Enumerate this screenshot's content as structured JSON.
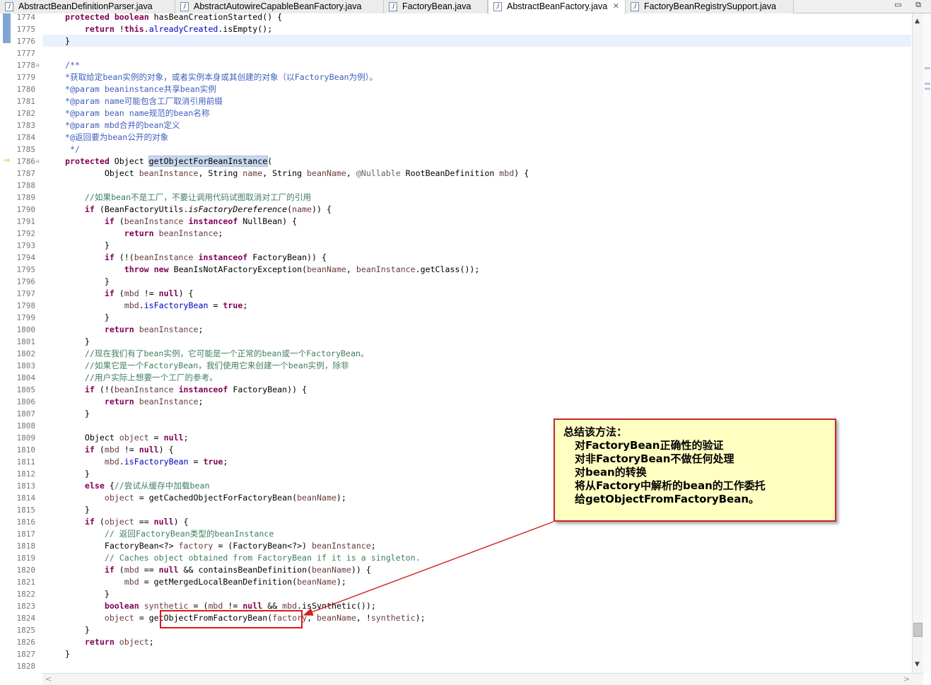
{
  "tabs": [
    {
      "label": "AbstractBeanDefinitionParser.java",
      "active": false
    },
    {
      "label": "AbstractAutowireCapableBeanFactory.java",
      "active": false
    },
    {
      "label": "FactoryBean.java",
      "active": false
    },
    {
      "label": "AbstractBeanFactory.java",
      "active": true,
      "close": "✕"
    },
    {
      "label": "FactoryBeanRegistrySupport.java",
      "active": false
    }
  ],
  "window_buttons": "▭ ⧉",
  "java_file_icon": "J",
  "editor": {
    "lines": [
      {
        "n": "1774",
        "segs": [
          [
            "kw",
            "protected"
          ],
          [
            "p",
            " "
          ],
          [
            "kw",
            "boolean"
          ],
          [
            "p",
            " hasBeanCreationStarted() {"
          ]
        ]
      },
      {
        "n": "1775",
        "segs": [
          [
            "p",
            "    "
          ],
          [
            "kw",
            "return"
          ],
          [
            "p",
            " !"
          ],
          [
            "kw",
            "this"
          ],
          [
            "p",
            "."
          ],
          [
            "fd",
            "alreadyCreated"
          ],
          [
            "p",
            ".isEmpty();"
          ]
        ]
      },
      {
        "n": "1776",
        "segs": [
          [
            "p",
            "}"
          ]
        ]
      },
      {
        "n": "1777",
        "segs": []
      },
      {
        "n": "1778",
        "segs": [
          [
            "jd",
            "/**"
          ]
        ]
      },
      {
        "n": "1779",
        "segs": [
          [
            "jd",
            "*获取给定bean实例的对象，或者实例本身或其创建的对象（以FactoryBean为例）。"
          ]
        ]
      },
      {
        "n": "1780",
        "segs": [
          [
            "jd",
            "*@param beaninstance共享bean实例"
          ]
        ]
      },
      {
        "n": "1781",
        "segs": [
          [
            "jd",
            "*@param name可能包含工厂取消引用前缀"
          ]
        ]
      },
      {
        "n": "1782",
        "segs": [
          [
            "jd",
            "*@param bean name规范的bean名称"
          ]
        ]
      },
      {
        "n": "1783",
        "segs": [
          [
            "jd",
            "*@param mbd合并的bean定义"
          ]
        ]
      },
      {
        "n": "1784",
        "segs": [
          [
            "jd",
            "*@返回要为bean公开的对象"
          ]
        ]
      },
      {
        "n": "1785",
        "segs": [
          [
            "jd",
            " */"
          ]
        ]
      },
      {
        "n": "1786",
        "segs": [
          [
            "kw",
            "protected"
          ],
          [
            "p",
            " Object "
          ],
          [
            "mh",
            "getObjectForBeanInstance"
          ],
          [
            "p",
            "("
          ]
        ]
      },
      {
        "n": "1787",
        "segs": [
          [
            "p",
            "        Object "
          ],
          [
            "lv",
            "beanInstance"
          ],
          [
            "p",
            ", String "
          ],
          [
            "lv",
            "name"
          ],
          [
            "p",
            ", String "
          ],
          [
            "lv",
            "beanName"
          ],
          [
            "p",
            ", "
          ],
          [
            "an",
            "@Nullable"
          ],
          [
            "p",
            " RootBeanDefinition "
          ],
          [
            "lv",
            "mbd"
          ],
          [
            "p",
            ") {"
          ]
        ]
      },
      {
        "n": "1788",
        "segs": []
      },
      {
        "n": "1789",
        "segs": [
          [
            "p",
            "    "
          ],
          [
            "cm",
            "//如果bean不是工厂，不要让调用代码试图取消对工厂的引用"
          ]
        ]
      },
      {
        "n": "1790",
        "segs": [
          [
            "p",
            "    "
          ],
          [
            "kw",
            "if"
          ],
          [
            "p",
            " (BeanFactoryUtils."
          ],
          [
            "it",
            "isFactoryDereference"
          ],
          [
            "p",
            "("
          ],
          [
            "lv",
            "name"
          ],
          [
            "p",
            ")) {"
          ]
        ]
      },
      {
        "n": "1791",
        "segs": [
          [
            "p",
            "        "
          ],
          [
            "kw",
            "if"
          ],
          [
            "p",
            " ("
          ],
          [
            "lv",
            "beanInstance"
          ],
          [
            "p",
            " "
          ],
          [
            "kw",
            "instanceof"
          ],
          [
            "p",
            " NullBean) {"
          ]
        ]
      },
      {
        "n": "1792",
        "segs": [
          [
            "p",
            "            "
          ],
          [
            "kw",
            "return"
          ],
          [
            "p",
            " "
          ],
          [
            "lv",
            "beanInstance"
          ],
          [
            "p",
            ";"
          ]
        ]
      },
      {
        "n": "1793",
        "segs": [
          [
            "p",
            "        }"
          ]
        ]
      },
      {
        "n": "1794",
        "segs": [
          [
            "p",
            "        "
          ],
          [
            "kw",
            "if"
          ],
          [
            "p",
            " (!("
          ],
          [
            "lv",
            "beanInstance"
          ],
          [
            "p",
            " "
          ],
          [
            "kw",
            "instanceof"
          ],
          [
            "p",
            " FactoryBean)) {"
          ]
        ]
      },
      {
        "n": "1795",
        "segs": [
          [
            "p",
            "            "
          ],
          [
            "kw",
            "throw"
          ],
          [
            "p",
            " "
          ],
          [
            "kw",
            "new"
          ],
          [
            "p",
            " BeanIsNotAFactoryException("
          ],
          [
            "lv",
            "beanName"
          ],
          [
            "p",
            ", "
          ],
          [
            "lv",
            "beanInstance"
          ],
          [
            "p",
            ".getClass());"
          ]
        ]
      },
      {
        "n": "1796",
        "segs": [
          [
            "p",
            "        }"
          ]
        ]
      },
      {
        "n": "1797",
        "segs": [
          [
            "p",
            "        "
          ],
          [
            "kw",
            "if"
          ],
          [
            "p",
            " ("
          ],
          [
            "lv",
            "mbd"
          ],
          [
            "p",
            " != "
          ],
          [
            "kw",
            "null"
          ],
          [
            "p",
            ") {"
          ]
        ]
      },
      {
        "n": "1798",
        "segs": [
          [
            "p",
            "            "
          ],
          [
            "lv",
            "mbd"
          ],
          [
            "p",
            "."
          ],
          [
            "fd",
            "isFactoryBean"
          ],
          [
            "p",
            " = "
          ],
          [
            "kw",
            "true"
          ],
          [
            "p",
            ";"
          ]
        ]
      },
      {
        "n": "1799",
        "segs": [
          [
            "p",
            "        }"
          ]
        ]
      },
      {
        "n": "1800",
        "segs": [
          [
            "p",
            "        "
          ],
          [
            "kw",
            "return"
          ],
          [
            "p",
            " "
          ],
          [
            "lv",
            "beanInstance"
          ],
          [
            "p",
            ";"
          ]
        ]
      },
      {
        "n": "1801",
        "segs": [
          [
            "p",
            "    }"
          ]
        ]
      },
      {
        "n": "1802",
        "segs": [
          [
            "p",
            "    "
          ],
          [
            "cm",
            "//现在我们有了bean实例，它可能是一个正常的bean或一个FactoryBean。"
          ]
        ]
      },
      {
        "n": "1803",
        "segs": [
          [
            "p",
            "    "
          ],
          [
            "cm",
            "//如果它是一个FactoryBean，我们使用它来创建一个bean实例，除非"
          ]
        ]
      },
      {
        "n": "1804",
        "segs": [
          [
            "p",
            "    "
          ],
          [
            "cm",
            "//用户实际上想要一个工厂的参考。"
          ]
        ]
      },
      {
        "n": "1805",
        "segs": [
          [
            "p",
            "    "
          ],
          [
            "kw",
            "if"
          ],
          [
            "p",
            " (!("
          ],
          [
            "lv",
            "beanInstance"
          ],
          [
            "p",
            " "
          ],
          [
            "kw",
            "instanceof"
          ],
          [
            "p",
            " FactoryBean)) {"
          ]
        ]
      },
      {
        "n": "1806",
        "segs": [
          [
            "p",
            "        "
          ],
          [
            "kw",
            "return"
          ],
          [
            "p",
            " "
          ],
          [
            "lv",
            "beanInstance"
          ],
          [
            "p",
            ";"
          ]
        ]
      },
      {
        "n": "1807",
        "segs": [
          [
            "p",
            "    }"
          ]
        ]
      },
      {
        "n": "1808",
        "segs": []
      },
      {
        "n": "1809",
        "segs": [
          [
            "p",
            "    Object "
          ],
          [
            "lv",
            "object"
          ],
          [
            "p",
            " = "
          ],
          [
            "kw",
            "null"
          ],
          [
            "p",
            ";"
          ]
        ]
      },
      {
        "n": "1810",
        "segs": [
          [
            "p",
            "    "
          ],
          [
            "kw",
            "if"
          ],
          [
            "p",
            " ("
          ],
          [
            "lv",
            "mbd"
          ],
          [
            "p",
            " != "
          ],
          [
            "kw",
            "null"
          ],
          [
            "p",
            ") {"
          ]
        ]
      },
      {
        "n": "1811",
        "segs": [
          [
            "p",
            "        "
          ],
          [
            "lv",
            "mbd"
          ],
          [
            "p",
            "."
          ],
          [
            "fd",
            "isFactoryBean"
          ],
          [
            "p",
            " = "
          ],
          [
            "kw",
            "true"
          ],
          [
            "p",
            ";"
          ]
        ]
      },
      {
        "n": "1812",
        "segs": [
          [
            "p",
            "    }"
          ]
        ]
      },
      {
        "n": "1813",
        "segs": [
          [
            "p",
            "    "
          ],
          [
            "kw",
            "else"
          ],
          [
            "p",
            " {"
          ],
          [
            "cm",
            "//尝试从缓存中加载bean"
          ]
        ]
      },
      {
        "n": "1814",
        "segs": [
          [
            "p",
            "        "
          ],
          [
            "lv",
            "object"
          ],
          [
            "p",
            " = getCachedObjectForFactoryBean("
          ],
          [
            "lv",
            "beanName"
          ],
          [
            "p",
            ");"
          ]
        ]
      },
      {
        "n": "1815",
        "segs": [
          [
            "p",
            "    }"
          ]
        ]
      },
      {
        "n": "1816",
        "segs": [
          [
            "p",
            "    "
          ],
          [
            "kw",
            "if"
          ],
          [
            "p",
            " ("
          ],
          [
            "lv",
            "object"
          ],
          [
            "p",
            " == "
          ],
          [
            "kw",
            "null"
          ],
          [
            "p",
            ") {"
          ]
        ]
      },
      {
        "n": "1817",
        "segs": [
          [
            "p",
            "        "
          ],
          [
            "cm",
            "// 返回FactoryBean类型的beanInstance"
          ]
        ]
      },
      {
        "n": "1818",
        "segs": [
          [
            "p",
            "        FactoryBean<?> "
          ],
          [
            "lv",
            "factory"
          ],
          [
            "p",
            " = (FactoryBean<?>) "
          ],
          [
            "lv",
            "beanInstance"
          ],
          [
            "p",
            ";"
          ]
        ]
      },
      {
        "n": "1819",
        "segs": [
          [
            "p",
            "        "
          ],
          [
            "cm",
            "// Caches object obtained from FactoryBean if it is a singleton."
          ]
        ]
      },
      {
        "n": "1820",
        "segs": [
          [
            "p",
            "        "
          ],
          [
            "kw",
            "if"
          ],
          [
            "p",
            " ("
          ],
          [
            "lv",
            "mbd"
          ],
          [
            "p",
            " == "
          ],
          [
            "kw",
            "null"
          ],
          [
            "p",
            " && containsBeanDefinition("
          ],
          [
            "lv",
            "beanName"
          ],
          [
            "p",
            ")) {"
          ]
        ]
      },
      {
        "n": "1821",
        "segs": [
          [
            "p",
            "            "
          ],
          [
            "lv",
            "mbd"
          ],
          [
            "p",
            " = getMergedLocalBeanDefinition("
          ],
          [
            "lv",
            "beanName"
          ],
          [
            "p",
            ");"
          ]
        ]
      },
      {
        "n": "1822",
        "segs": [
          [
            "p",
            "        }"
          ]
        ]
      },
      {
        "n": "1823",
        "segs": [
          [
            "p",
            "        "
          ],
          [
            "kw",
            "boolean"
          ],
          [
            "p",
            " "
          ],
          [
            "lv",
            "synthetic"
          ],
          [
            "p",
            " = ("
          ],
          [
            "lv",
            "mbd"
          ],
          [
            "p",
            " != "
          ],
          [
            "kw",
            "null"
          ],
          [
            "p",
            " && "
          ],
          [
            "lv",
            "mbd"
          ],
          [
            "p",
            ".isSynthetic());"
          ]
        ]
      },
      {
        "n": "1824",
        "segs": [
          [
            "p",
            "        "
          ],
          [
            "lv",
            "object"
          ],
          [
            "p",
            " = getObjectFromFactoryBean("
          ],
          [
            "lv",
            "factory"
          ],
          [
            "p",
            ", "
          ],
          [
            "lv",
            "beanName"
          ],
          [
            "p",
            ", !"
          ],
          [
            "lv",
            "synthetic"
          ],
          [
            "p",
            ");"
          ]
        ]
      },
      {
        "n": "1825",
        "segs": [
          [
            "p",
            "    }"
          ]
        ]
      },
      {
        "n": "1826",
        "segs": [
          [
            "p",
            "    "
          ],
          [
            "kw",
            "return"
          ],
          [
            "p",
            " "
          ],
          [
            "lv",
            "object"
          ],
          [
            "p",
            ";"
          ]
        ]
      },
      {
        "n": "1827",
        "segs": [
          [
            "p",
            "}"
          ]
        ]
      },
      {
        "n": "1828",
        "segs": []
      }
    ]
  },
  "annotation": {
    "title": "总结该方法：",
    "items": [
      "对FactoryBean正确性的验证",
      "对非FactoryBean不做任何处理",
      "对bean的转换",
      "将从Factory中解析的bean的工作委托",
      "给getObjectFromFactoryBean。"
    ]
  },
  "scroll": {
    "up": "▲",
    "down": "▼",
    "left": "<",
    "right": ">"
  },
  "colors": {
    "keyword": "#7f0055",
    "comment": "#3f7f5f",
    "javadoc": "#3f5fbf",
    "field": "#0000c0",
    "annotation_border": "#c62828",
    "annotation_bg": "#ffffc2"
  }
}
